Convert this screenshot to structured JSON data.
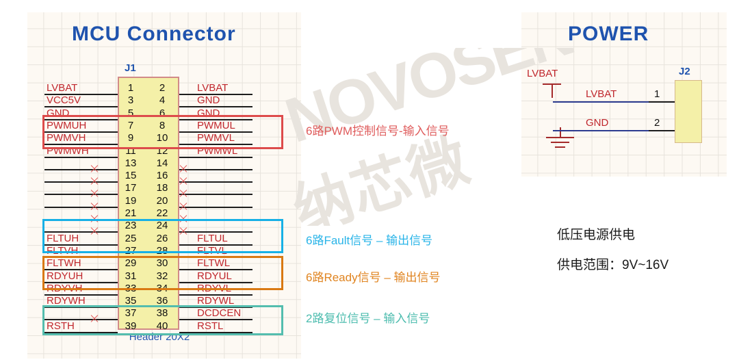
{
  "sections": {
    "mcu_title": "MCU  Connector",
    "power_title": "POWER"
  },
  "j1": {
    "ref": "J1",
    "footprint": "Header 20X2",
    "rows": [
      {
        "odd": "1",
        "even": "2",
        "left": "LVBAT",
        "right": "LVBAT",
        "left_nc": false,
        "right_nc": false
      },
      {
        "odd": "3",
        "even": "4",
        "left": "VCC5V",
        "right": "GND",
        "left_nc": false,
        "right_nc": false
      },
      {
        "odd": "5",
        "even": "6",
        "left": "GND",
        "right": "GND",
        "left_nc": false,
        "right_nc": false
      },
      {
        "odd": "7",
        "even": "8",
        "left": "PWMUH",
        "right": "PWMUL",
        "left_nc": false,
        "right_nc": false
      },
      {
        "odd": "9",
        "even": "10",
        "left": "PWMVH",
        "right": "PWMVL",
        "left_nc": false,
        "right_nc": false
      },
      {
        "odd": "11",
        "even": "12",
        "left": "PWMWH",
        "right": "PWMWL",
        "left_nc": false,
        "right_nc": false
      },
      {
        "odd": "13",
        "even": "14",
        "left": "",
        "right": "",
        "left_nc": true,
        "right_nc": true
      },
      {
        "odd": "15",
        "even": "16",
        "left": "",
        "right": "",
        "left_nc": true,
        "right_nc": true
      },
      {
        "odd": "17",
        "even": "18",
        "left": "",
        "right": "",
        "left_nc": true,
        "right_nc": true
      },
      {
        "odd": "19",
        "even": "20",
        "left": "",
        "right": "",
        "left_nc": true,
        "right_nc": true
      },
      {
        "odd": "21",
        "even": "22",
        "left": "",
        "right": "",
        "left_nc": true,
        "right_nc": true
      },
      {
        "odd": "23",
        "even": "24",
        "left": "",
        "right": "",
        "left_nc": true,
        "right_nc": true
      },
      {
        "odd": "25",
        "even": "26",
        "left": "FLTUH",
        "right": "FLTUL",
        "left_nc": false,
        "right_nc": false
      },
      {
        "odd": "27",
        "even": "28",
        "left": "FLTVH",
        "right": "FLTVL",
        "left_nc": false,
        "right_nc": false
      },
      {
        "odd": "29",
        "even": "30",
        "left": "FLTWH",
        "right": "FLTWL",
        "left_nc": false,
        "right_nc": false
      },
      {
        "odd": "31",
        "even": "32",
        "left": "RDYUH",
        "right": "RDYUL",
        "left_nc": false,
        "right_nc": false
      },
      {
        "odd": "33",
        "even": "34",
        "left": "RDYVH",
        "right": "RDYVL",
        "left_nc": false,
        "right_nc": false
      },
      {
        "odd": "35",
        "even": "36",
        "left": "RDYWH",
        "right": "RDYWL",
        "left_nc": false,
        "right_nc": false
      },
      {
        "odd": "37",
        "even": "38",
        "left": "",
        "right": "DCDCEN",
        "left_nc": true,
        "right_nc": false
      },
      {
        "odd": "39",
        "even": "40",
        "left": "RSTH",
        "right": "RSTL",
        "left_nc": false,
        "right_nc": false
      }
    ]
  },
  "groups": [
    {
      "id": "pwm",
      "color": "#dd4b4b",
      "annotation": "6路PWM控制信号-输入信号"
    },
    {
      "id": "fault",
      "color": "#17b0e6",
      "annotation": "6路Fault信号 – 输出信号"
    },
    {
      "id": "ready",
      "color": "#d97913",
      "annotation": "6路Ready信号 – 输出信号"
    },
    {
      "id": "reset",
      "color": "#54bdae",
      "annotation": "2路复位信号 – 输入信号"
    }
  ],
  "power": {
    "ref": "J2",
    "flag_label": "LVBAT",
    "nets": [
      {
        "label": "LVBAT",
        "pin": "1"
      },
      {
        "label": "GND",
        "pin": "2"
      }
    ],
    "notes": [
      "低压电源供电",
      "供电范围：9V~16V"
    ]
  },
  "watermark": {
    "en": "NOVOSENSE",
    "cn": "纳芯微"
  },
  "colors": {
    "title_blue": "#1f53ae",
    "net_red": "#c0272d",
    "connector_fill": "#f4f0a8",
    "pwm_red": "#dd4b4b",
    "fault_cyan": "#17b0e6",
    "ready_orange": "#d97913",
    "reset_teal": "#54bdae",
    "sheet_bg": "#fdf9f3"
  }
}
